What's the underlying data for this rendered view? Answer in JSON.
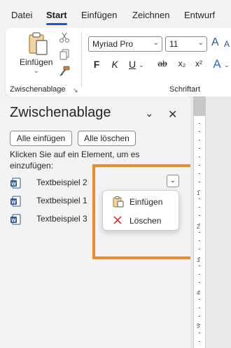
{
  "tabs": [
    "Datei",
    "Start",
    "Einfügen",
    "Zeichnen",
    "Entwurf"
  ],
  "active_tab": "Start",
  "ribbon": {
    "clipboard": {
      "paste_label": "Einfügen",
      "group_label": "Zwischenablage",
      "cut_icon": "scissors-icon",
      "copy_icon": "copy-icon",
      "format_painter_icon": "format-painter-icon"
    },
    "font": {
      "font_name": "Myriad Pro",
      "font_size": "11",
      "grow_label": "A",
      "shrink_label": "A",
      "bold": "F",
      "italic": "K",
      "underline": "U",
      "strike": "ab",
      "subscript": "x₂",
      "superscript": "x²",
      "text_effects": "A",
      "group_label": "Schriftart"
    }
  },
  "pane": {
    "title": "Zwischenablage",
    "paste_all": "Alle einfügen",
    "clear_all": "Alle löschen",
    "hint_line1": "Klicken Sie auf ein Element, um es",
    "hint_line2": "einzufügen:",
    "items": [
      {
        "label": "Textbeispiel 2"
      },
      {
        "label": "Textbeispiel 1"
      },
      {
        "label": "Textbeispiel 3"
      }
    ],
    "context_menu": {
      "paste": "Einfügen",
      "delete": "Löschen"
    }
  },
  "ruler": {
    "numbers": [
      "1",
      "2",
      "3",
      "4",
      "5"
    ]
  },
  "colors": {
    "accent": "#185abd",
    "highlight": "#f08a30",
    "delete": "#d13438",
    "word_blue": "#2b579a"
  }
}
